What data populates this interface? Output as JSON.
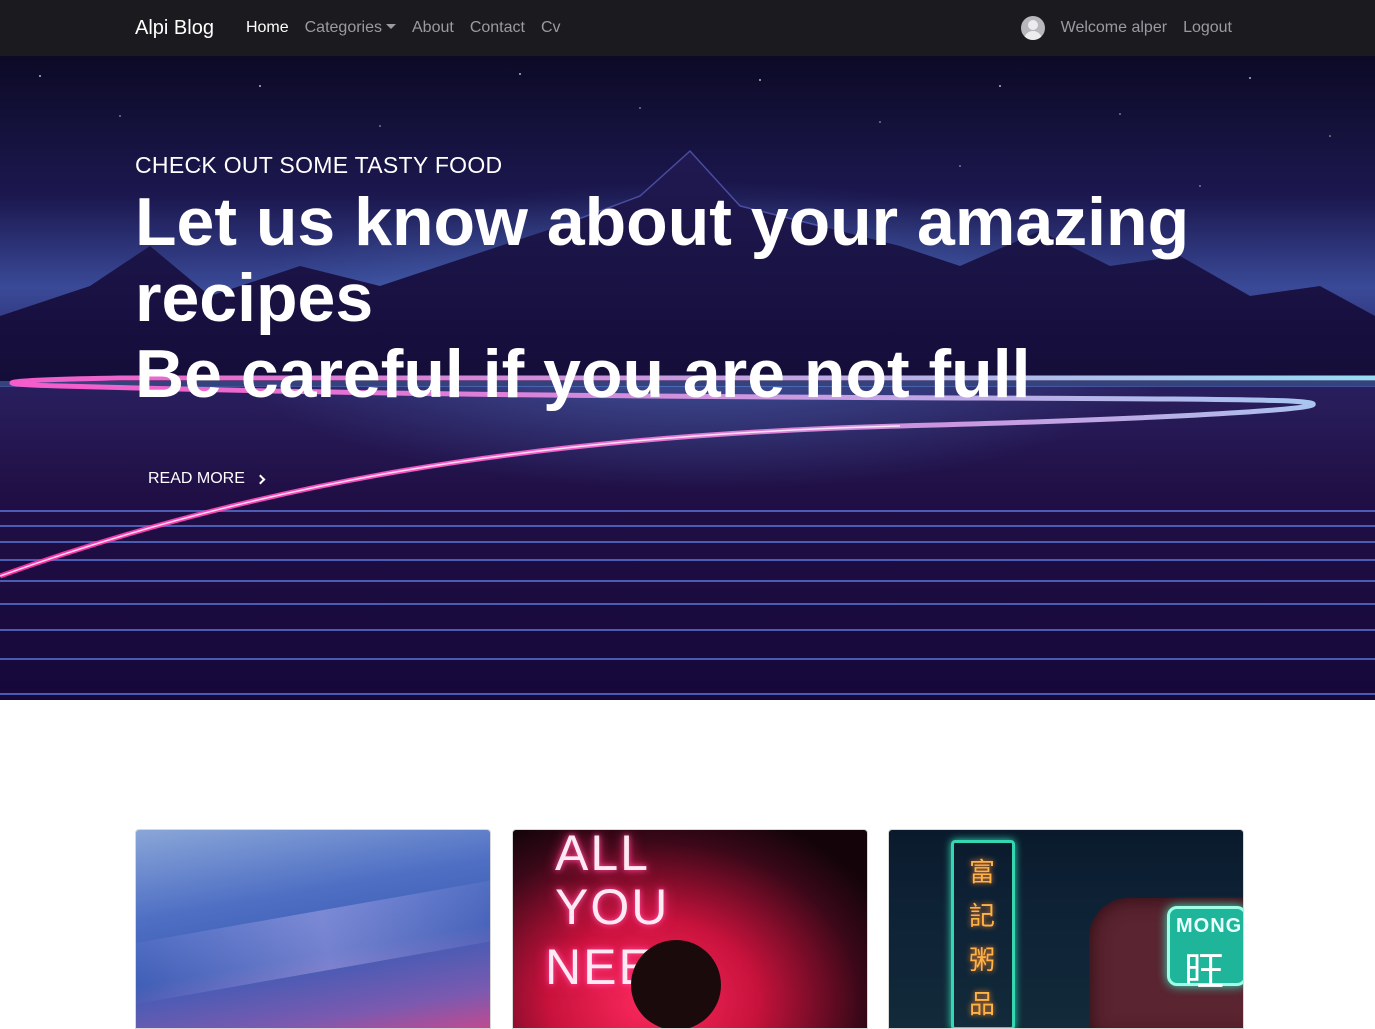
{
  "navbar": {
    "brand": "Alpi Blog",
    "links": [
      {
        "label": "Home",
        "active": true
      },
      {
        "label": "Categories",
        "dropdown": true
      },
      {
        "label": "About"
      },
      {
        "label": "Contact"
      },
      {
        "label": "Cv"
      }
    ],
    "user": {
      "welcome": "Welcome alper",
      "logout": "Logout",
      "avatar_icon": "user-avatar-icon"
    }
  },
  "hero": {
    "subtitle": "CHECK OUT SOME TASTY FOOD",
    "title_line1": "Let us know about your amazing recipes",
    "title_line2": "Be careful if you are not full",
    "read_more": "READ MORE",
    "read_more_icon": "chevron-right-icon"
  },
  "cards": [
    {
      "image": "sky-clouds-image"
    },
    {
      "image": "neon-sign-image",
      "neon_text": [
        "ALL",
        "YOU",
        "NEE"
      ]
    },
    {
      "image": "night-street-image",
      "sign_glyphs": [
        "富",
        "記",
        "粥",
        "品"
      ],
      "taxi_label": "MONG",
      "taxi_glyph": "旺"
    }
  ],
  "colors": {
    "navbar_bg": "#1b1a1f",
    "nav_active": "#ffffff",
    "nav_inactive": "#9a9aa0",
    "neon_pink": "#ff2fa6",
    "neon_cyan": "#9fe6ff"
  }
}
